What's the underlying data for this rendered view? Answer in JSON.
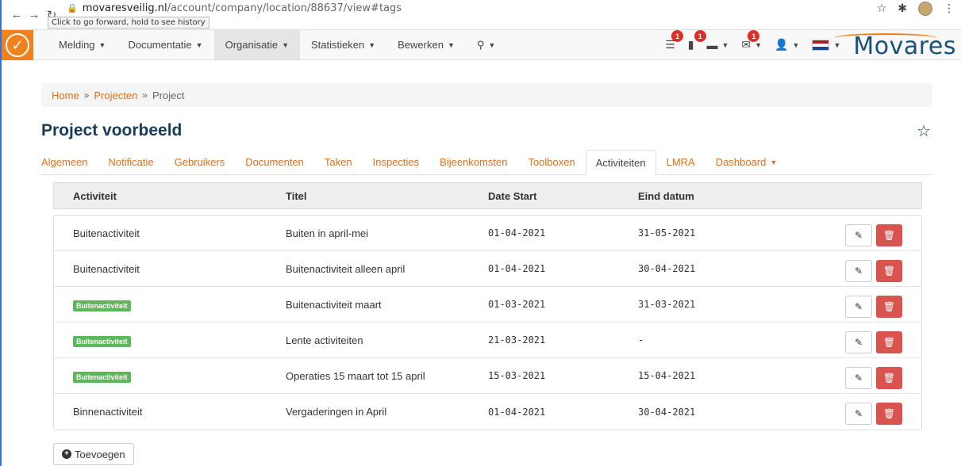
{
  "browser": {
    "url_host": "movaresveilig.nl",
    "url_path": "/account/company/location/88637/view#tags",
    "tooltip": "Click to go forward, hold to see history"
  },
  "navbar": {
    "menu": [
      {
        "label": "Melding"
      },
      {
        "label": "Documentatie"
      },
      {
        "label": "Organisatie"
      },
      {
        "label": "Statistieken"
      },
      {
        "label": "Bewerken"
      }
    ],
    "badges": {
      "list": "1",
      "file": "1",
      "mail": "1"
    },
    "brand": "Movares",
    "colors": {
      "accent": "#f0821e",
      "brand": "#1a5276",
      "badge": "#d9302c"
    }
  },
  "breadcrumb": {
    "home": "Home",
    "sep1": "»",
    "projecten": "Projecten",
    "sep2": "»",
    "current": "Project"
  },
  "page": {
    "title": "Project voorbeeld"
  },
  "tabs": [
    {
      "label": "Algemeen"
    },
    {
      "label": "Notificatie"
    },
    {
      "label": "Gebruikers"
    },
    {
      "label": "Documenten"
    },
    {
      "label": "Taken"
    },
    {
      "label": "Inspecties"
    },
    {
      "label": "Bijeenkomsten"
    },
    {
      "label": "Toolboxen"
    },
    {
      "label": "Activiteiten"
    },
    {
      "label": "LMRA"
    },
    {
      "label": "Dashboard"
    }
  ],
  "table": {
    "headers": [
      "Activiteit",
      "Titel",
      "Date Start",
      "Eind datum"
    ],
    "rows": [
      {
        "activiteit": "Buitenactiviteit",
        "label": false,
        "titel": "Buiten in april-mei",
        "start": "01-04-2021",
        "eind": "31-05-2021"
      },
      {
        "activiteit": "Buitenactiviteit",
        "label": false,
        "titel": "Buitenactiviteit alleen april",
        "start": "01-04-2021",
        "eind": "30-04-2021"
      },
      {
        "activiteit": "Buitenactiviteit",
        "label": true,
        "titel": "Buitenactiviteit maart",
        "start": "01-03-2021",
        "eind": "31-03-2021"
      },
      {
        "activiteit": "Buitenactiviteit",
        "label": true,
        "titel": "Lente activiteiten",
        "start": "21-03-2021",
        "eind": "-"
      },
      {
        "activiteit": "Buitenactiviteit",
        "label": true,
        "titel": "Operaties 15 maart tot 15 april",
        "start": "15-03-2021",
        "eind": "15-04-2021"
      },
      {
        "activiteit": "Binnenactiviteit",
        "label": false,
        "titel": "Vergaderingen in April",
        "start": "01-04-2021",
        "eind": "30-04-2021"
      }
    ]
  },
  "add_button": {
    "label": "Toevoegen"
  }
}
